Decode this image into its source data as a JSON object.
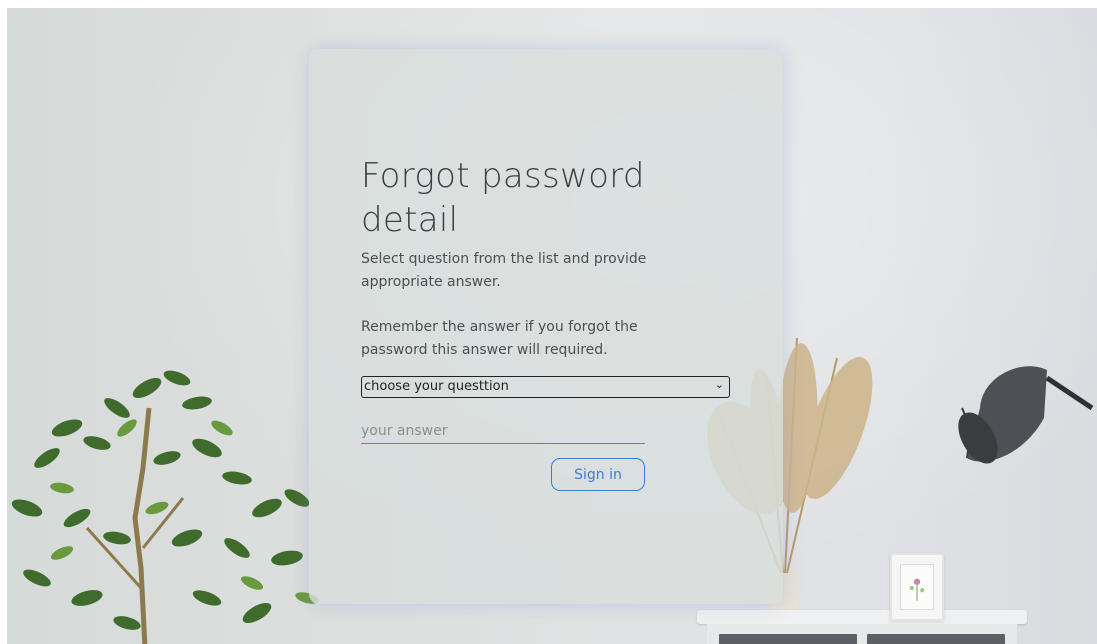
{
  "form": {
    "title": "Forgot password detail",
    "description_1": "Select question from the list and provide appropriate answer.",
    "description_2": "Remember the answer if you forgot the password this answer will required.",
    "question_select": {
      "selected": "choose your questtion",
      "options": [
        "choose your questtion"
      ]
    },
    "answer_placeholder": "your answer",
    "answer_value": "",
    "submit_label": "Sign in"
  },
  "colors": {
    "accent": "#3f7bd4",
    "title_text": "#3b3f42",
    "body_text": "#4b4f52"
  },
  "icons": {
    "select_arrow": "chevron-down-icon"
  }
}
